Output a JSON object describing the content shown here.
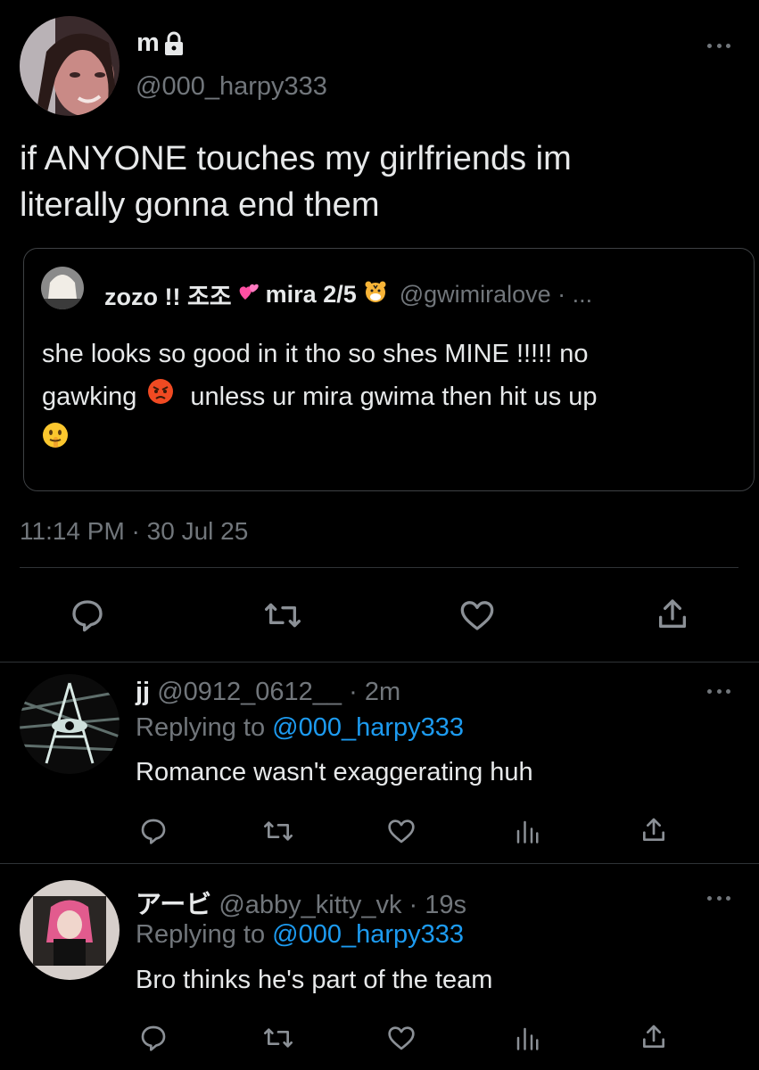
{
  "main_tweet": {
    "display_name": "m",
    "handle": "@000_harpy333",
    "text_line1": "if ANYONE touches my girlfriends im",
    "text_line2": "literally gonna end them",
    "timestamp": "11:14 PM · 30 Jul 25",
    "quoted": {
      "display_name_part1": "zozo !! 조조",
      "display_name_part2": "mira 2/5",
      "handle": "@gwimiralove · ...",
      "text_line1": "she looks so good in it tho so shes MINE !!!!! no",
      "text_line2_a": "gawking",
      "text_line2_b": "unless ur mira gwima then hit us up"
    }
  },
  "replies": [
    {
      "display_name": "jj",
      "handle": "@0912_0612__",
      "time": "· 2m",
      "replying_prefix": "Replying to",
      "replying_handle": "@000_harpy333",
      "text": "Romance wasn't exaggerating huh"
    },
    {
      "display_name": "アービ",
      "handle": "@abby_kitty_vk",
      "time": "· 19s",
      "replying_prefix": "Replying to",
      "replying_handle": "@000_harpy333",
      "text": "Bro thinks he's part of the team"
    }
  ],
  "colors": {
    "background": "#000000",
    "text": "#e7e9ea",
    "secondary": "#71767b",
    "link": "#1d9bf0",
    "border": "#2f3336"
  },
  "icons": [
    "lock-icon",
    "more-icon",
    "reply-icon",
    "retweet-icon",
    "like-icon",
    "share-icon",
    "analytics-icon",
    "sparkling-heart-emoji",
    "tiger-emoji",
    "angry-face-emoji",
    "shushing-face-emoji"
  ]
}
